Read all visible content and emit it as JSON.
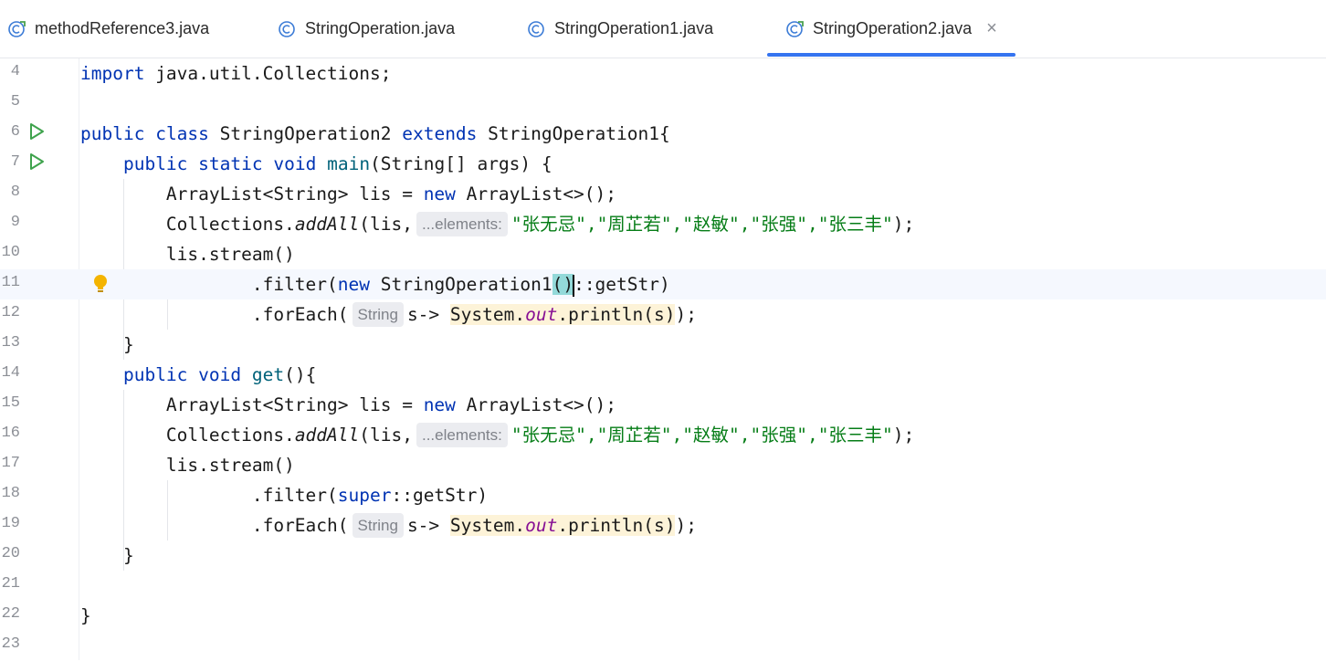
{
  "tabs": [
    {
      "label": "methodReference3.java",
      "active": false
    },
    {
      "label": "StringOperation.java",
      "active": false
    },
    {
      "label": "StringOperation1.java",
      "active": false
    },
    {
      "label": "StringOperation2.java",
      "active": true
    }
  ],
  "close_glyph": "×",
  "icons": {
    "tab_file": "java-class-icon",
    "run": "run-gutter-icon",
    "intention": "lightbulb-icon"
  },
  "colors": {
    "accent": "#3574f0",
    "keyword": "#0033b3",
    "string": "#067d17"
  },
  "editor": {
    "current_line": 11,
    "line_numbers": [
      "4",
      "5",
      "6",
      "7",
      "8",
      "9",
      "10",
      "11",
      "12",
      "13",
      "14",
      "15",
      "16",
      "17",
      "18",
      "19",
      "20",
      "21",
      "22",
      "23"
    ],
    "hints": {
      "elements": "...elements:",
      "string_type": "String"
    },
    "tokens": {
      "import_kw": "import",
      "import_path": " java.util.Collections;",
      "public": "public",
      "class": "class",
      "class_name": " StringOperation2 ",
      "extends": "extends",
      "parent": " StringOperation1{",
      "static": "static",
      "void": "void",
      "main": "main",
      "main_params": "(String[] args) {",
      "arraylist_decl": "ArrayList<String> lis = ",
      "new": "new",
      "arraylist_ctor": " ArrayList<>();",
      "collections": "Collections.",
      "addall": "addAll",
      "addall_open": "(lis,",
      "strings": "\"张无忌\",\"周芷若\",\"赵敏\",\"张强\",\"张三丰\"",
      "close_paren_semi": ");",
      "stream": "lis.stream()",
      "filter_open": ".filter(",
      "so1": " StringOperation1",
      "parens": "()",
      "get_str_ref": "::getStr)",
      "foreach_open": ".forEach(",
      "lambda": "s-> ",
      "system": "System.",
      "out": "out",
      "println": ".println(s)",
      "after_println": ");",
      "close_brace": "}",
      "get": "get",
      "get_sig": "(){",
      "super": "super",
      "super_ref": "::getStr)"
    }
  }
}
